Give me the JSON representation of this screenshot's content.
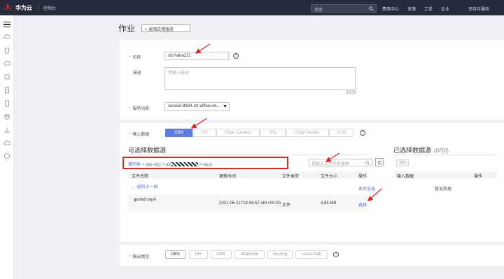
{
  "topbar": {
    "brand": "华为云",
    "console": "控制台",
    "search_placeholder": "搜索",
    "nav": [
      "费用中心",
      "资源",
      "工单",
      "企业",
      "支持与服务"
    ]
  },
  "page": {
    "title": "作业",
    "back_label": "< 返回应用服务"
  },
  "form": {
    "name_label": "名称",
    "name_value": "xlz-haha221",
    "desc_label": "描述",
    "desc_placeholder": "请输入描述",
    "desc_counter": "0/500",
    "service_label": "服务功能",
    "service_value": "service-8664-xlz-aiflow-ok...",
    "input_label": "输入数据",
    "input_options": [
      "OBS",
      "VIS",
      "Edge Camera",
      "URL",
      "Edge Restful",
      "VCN"
    ]
  },
  "sources": {
    "title": "可选择数据源",
    "breadcrumb": {
      "root": "桶列表",
      "parts": [
        "> obs-xlz1 > aifl",
        "> input"
      ]
    },
    "search_placeholder": "请输入文件名称搜索",
    "columns": [
      "文件名称",
      "更新时间",
      "文件类型",
      "文件大小",
      "操作"
    ],
    "back_up": "← 返回上一级",
    "select_all": "本页全选",
    "file": {
      "name": "genhdr.mp4",
      "updated": "2021-05-21T02:08:57.481+00:00",
      "type": "文件",
      "size": "4.85 MB",
      "action": "选择"
    }
  },
  "selected": {
    "title": "已选择数据源",
    "count": "(0/50)",
    "clear_label": "清空",
    "columns": [
      "输入数据",
      "操作"
    ],
    "empty": "暂无数据"
  },
  "output": {
    "label": "输出类型",
    "options": [
      "OBS",
      "DIS",
      "DMS",
      "Webhook",
      "Hosting",
      "Local Path"
    ]
  },
  "colors": {
    "accent": "#5e7ce0",
    "link": "#526ecc",
    "annotation": "#e8231f",
    "topbar": "#252b3a"
  }
}
